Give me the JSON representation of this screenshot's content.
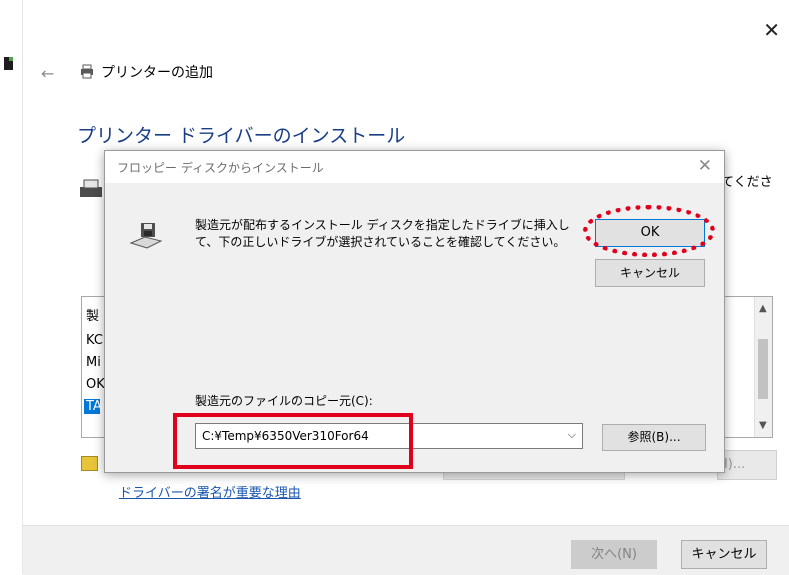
{
  "wizard": {
    "title": "プリンターの追加",
    "heading": "プリンター ドライバーのインストール",
    "side_text": "てくださ",
    "list_items": [
      "製",
      "KC",
      "Mi",
      "OK",
      "TA"
    ],
    "button_h_label": "H)...",
    "signature_link": "ドライバーの署名が重要な理由",
    "next_button": "次へ(N)",
    "cancel_button": "キャンセル"
  },
  "dialog": {
    "title": "フロッピー ディスクからインストール",
    "message": "製造元が配布するインストール ディスクを指定したドライブに挿入して、下の正しいドライブが選択されていることを確認してください。",
    "ok_label": "OK",
    "cancel_label": "キャンセル",
    "copy_from_label": "製造元のファイルのコピー元(C):",
    "copy_from_value": "C:¥Temp¥6350Ver310For64",
    "browse_label": "参照(B)..."
  },
  "icons": {
    "close": "close-icon",
    "back": "back-arrow-icon",
    "printer": "printer-icon",
    "floppy": "floppy-disk-icon",
    "dropdown": "chevron-down-icon"
  },
  "colors": {
    "heading": "#1a3e86",
    "link": "#1a56b0",
    "selection": "#0078d7",
    "annotation": "#e0001b"
  }
}
